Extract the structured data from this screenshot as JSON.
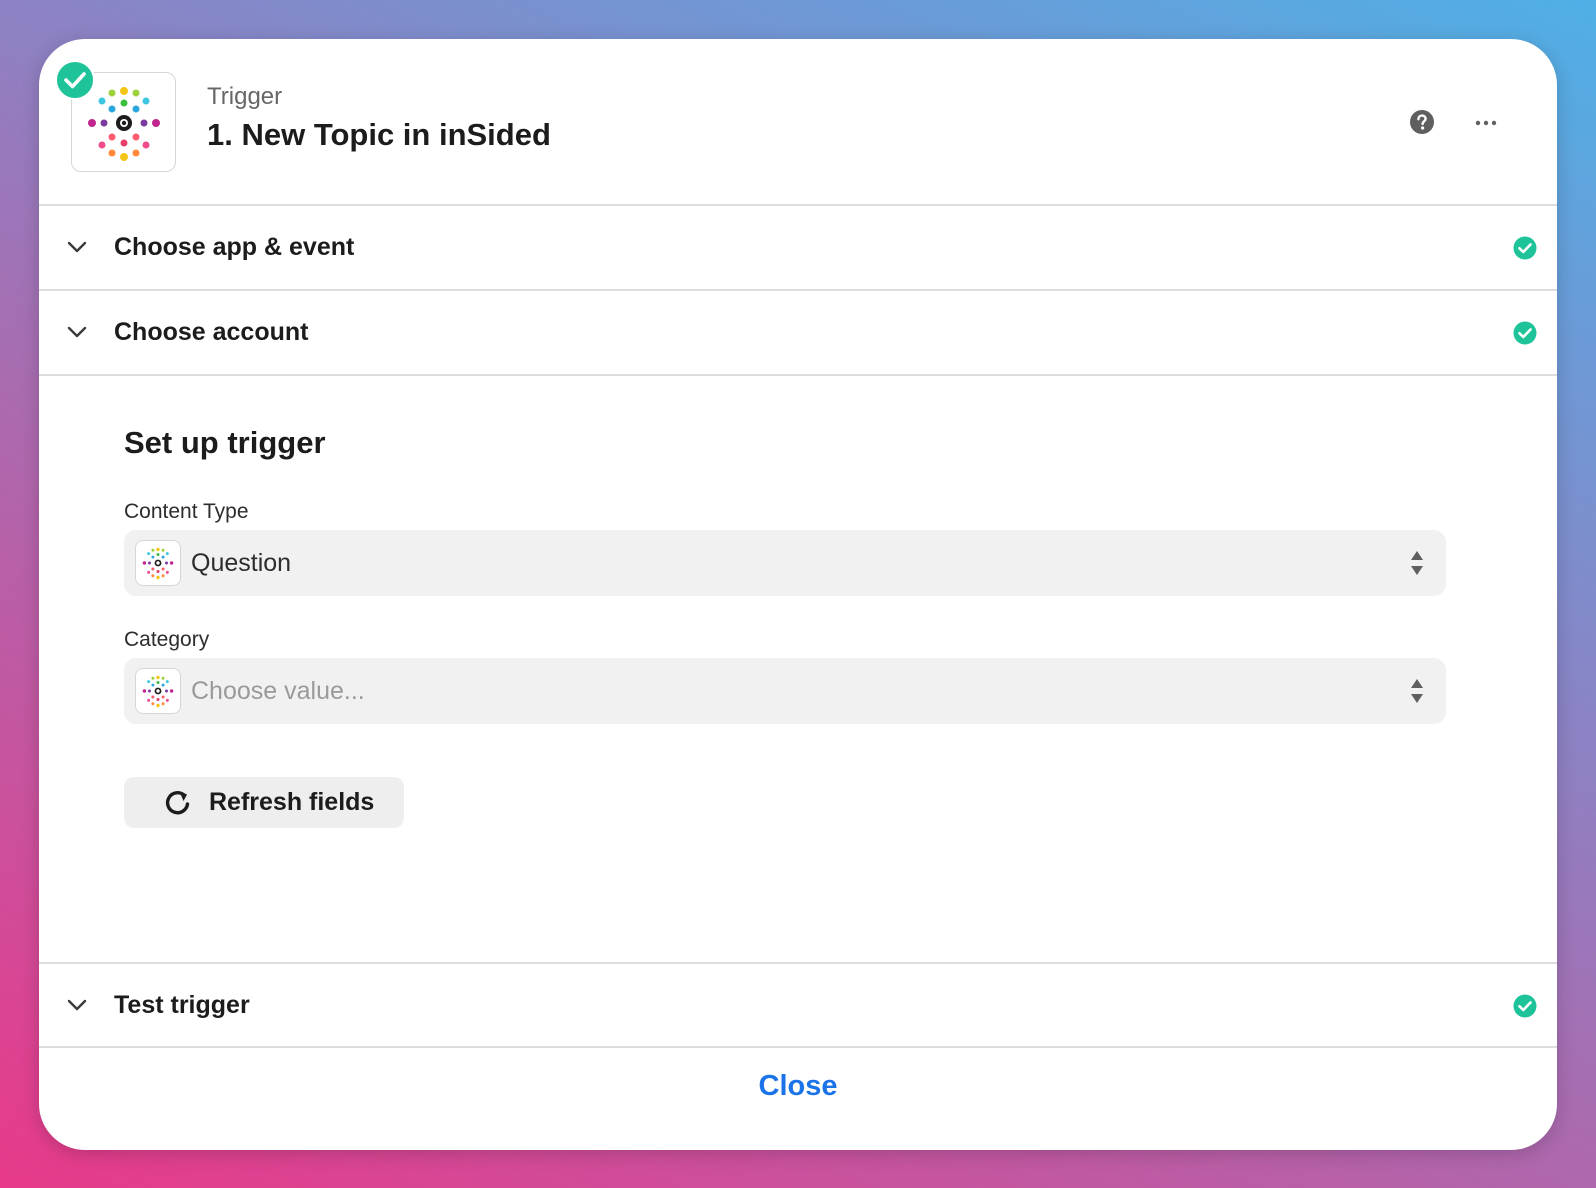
{
  "header": {
    "kicker": "Trigger",
    "title": "1. New Topic in inSided",
    "app_icon": "insided-logo",
    "status_icon": "check-circle-icon",
    "actions": [
      "help-icon",
      "more-icon"
    ]
  },
  "sections": {
    "choose_app": {
      "label": "Choose app & event",
      "status": "complete"
    },
    "choose_account": {
      "label": "Choose account",
      "status": "complete"
    },
    "test_trigger": {
      "label": "Test trigger",
      "status": "complete"
    }
  },
  "setup": {
    "title": "Set up trigger",
    "fields": [
      {
        "label": "Content Type",
        "value": "Question",
        "placeholder": ""
      },
      {
        "label": "Category",
        "value": "",
        "placeholder": "Choose value..."
      }
    ],
    "refresh_label": "Refresh fields"
  },
  "footer": {
    "close_label": "Close"
  },
  "colors": {
    "success": "#1fc39a",
    "link": "#1a73e8"
  }
}
